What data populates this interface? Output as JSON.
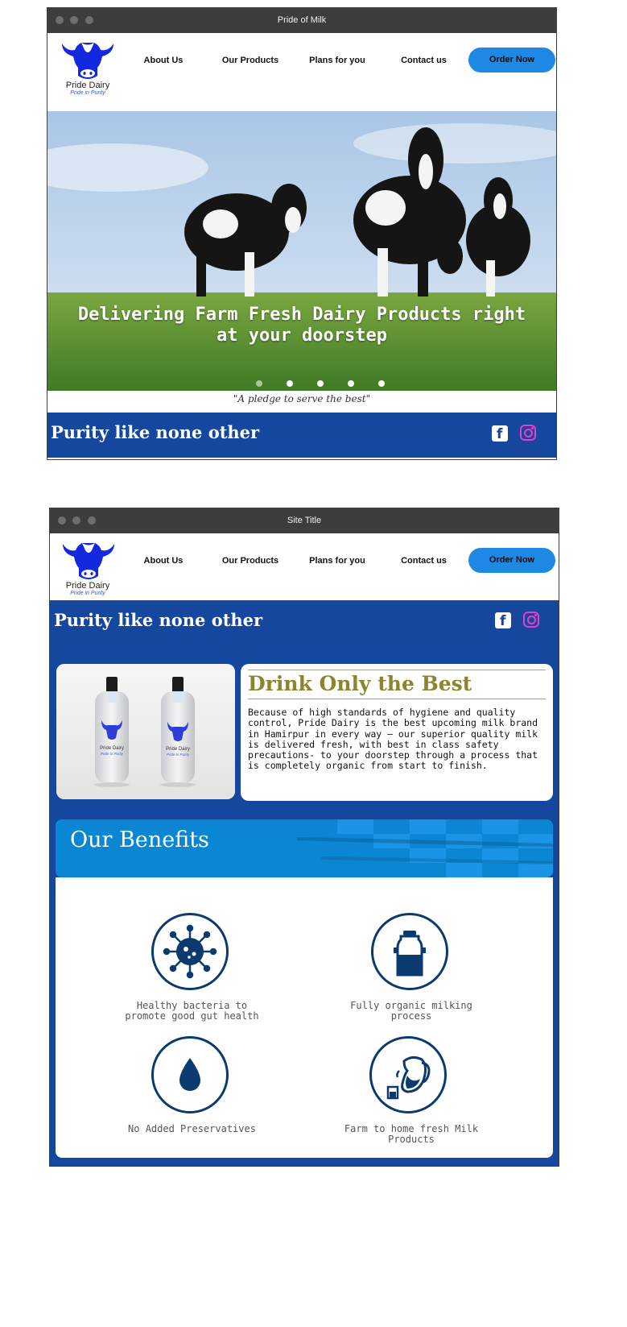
{
  "colors": {
    "brand_blue": "#16479e",
    "order_button": "#1e88e5",
    "accent_gold": "#8d852e",
    "instagram": "#e03fd0",
    "titlebar": "#3d3d3d"
  },
  "window1": {
    "title": "Pride of Milk",
    "logo": {
      "name": "Pride Dairy",
      "tagline": "Pride in Purity",
      "icon": "cow-head-icon"
    },
    "nav": [
      {
        "label": "About Us"
      },
      {
        "label": "Our Products"
      },
      {
        "label": "Plans for you"
      },
      {
        "label": "Contact us"
      }
    ],
    "order_button": "Order Now",
    "hero": {
      "headline": "Delivering Farm Fresh Dairy Products right at your doorstep",
      "slide_count": 5,
      "active_slide": 1
    },
    "pledge": "\"A pledge to serve the best\"",
    "tagline": "Purity like none other",
    "social": [
      "facebook-icon",
      "instagram-icon"
    ]
  },
  "window2": {
    "title": "Site Title",
    "logo": {
      "name": "Pride Dairy",
      "tagline": "Pride in Purity",
      "icon": "cow-head-icon"
    },
    "nav": [
      {
        "label": "About Us"
      },
      {
        "label": "Our Products"
      },
      {
        "label": "Plans for you"
      },
      {
        "label": "Contact us"
      }
    ],
    "order_button": "Order Now",
    "tagline": "Purity like none other",
    "social": [
      "facebook-icon",
      "instagram-icon"
    ],
    "product_image": {
      "bottle_brand": "Pride Dairy",
      "bottle_tagline": "Pride in Purity",
      "bottle_count": 2
    },
    "drink": {
      "title": "Drink Only the Best",
      "body": "Because of high standards of hygiene and quality control, Pride Dairy is the best upcoming milk brand in Hamirpur in every way — our superior quality milk is delivered fresh, with best in class safety precautions- to your doorstep through a process that is completely organic from start to finish."
    },
    "benefits": {
      "title": "Our Benefits",
      "items": [
        {
          "label": "Healthy bacteria to promote good gut health",
          "icon": "bacteria-icon"
        },
        {
          "label": "Fully organic milking process",
          "icon": "milk-can-icon"
        },
        {
          "label": "No Added Preservatives",
          "icon": "water-drop-icon"
        },
        {
          "label": "Farm to home fresh Milk Products",
          "icon": "milk-jug-icon"
        }
      ]
    }
  }
}
